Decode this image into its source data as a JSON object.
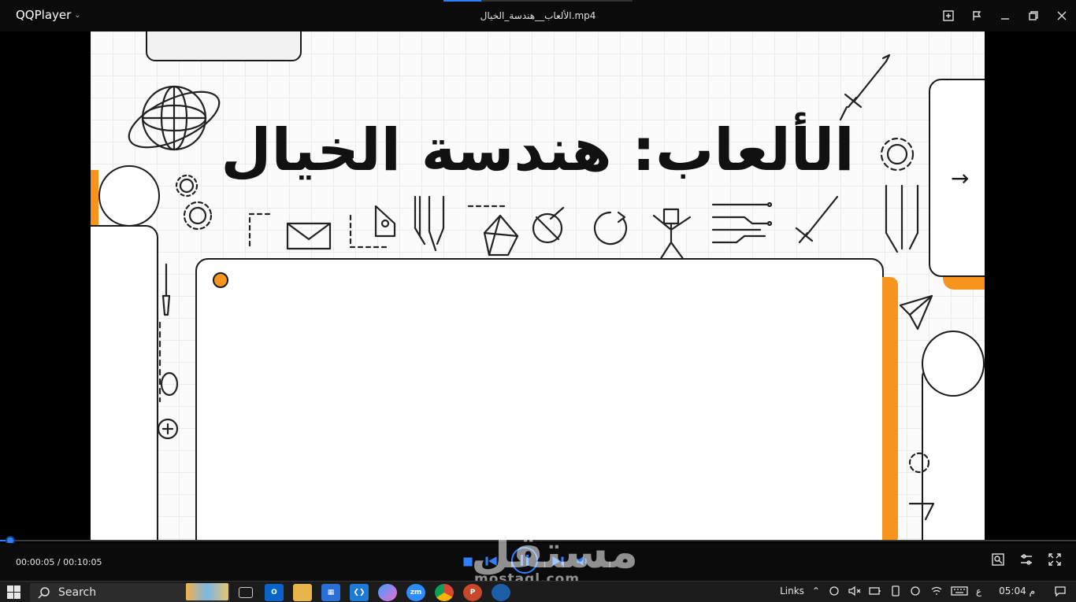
{
  "app": {
    "name": "QQPlayer",
    "file_title": "الألعاب__هندسة_الخيال.mp4"
  },
  "slide": {
    "title": "الألعاب: هندسة الخيال"
  },
  "player": {
    "time_current": "00:00:05",
    "time_total": "00:10:05",
    "time_display": "00:00:05 / 00:10:05",
    "progress_fraction": 0.008,
    "accent_color": "#2f80ff"
  },
  "watermark": {
    "main": "مستقل",
    "sub": "mostaql.com"
  },
  "taskbar": {
    "search_label": "Search",
    "links_label": "Links",
    "lang_label": "ع",
    "clock": "05:04 م",
    "apps": [
      "task-view-icon",
      "outlook-icon",
      "file-explorer-icon",
      "store-icon",
      "vscode-icon",
      "copilot-icon",
      "zoom-icon",
      "chrome-icon",
      "powerpoint-icon",
      "app-icon"
    ]
  },
  "colors": {
    "orange": "#f7941d",
    "titlebar": "#0b0b0b"
  }
}
